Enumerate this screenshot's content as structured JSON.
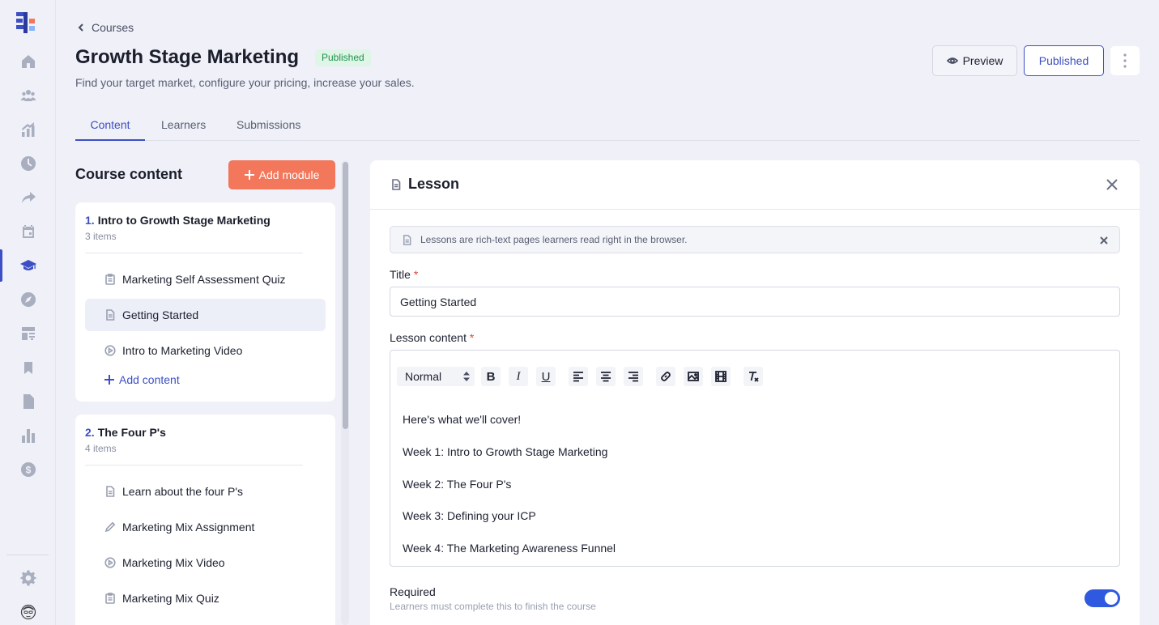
{
  "sidebar": {
    "icons": [
      "home-icon",
      "people-icon",
      "chart-up-icon",
      "clock-icon",
      "share-icon",
      "calendar-icon",
      "graduation-cap-icon",
      "compass-icon",
      "desk-icon",
      "bookmark-icon",
      "document-icon",
      "bar-chart-icon",
      "dollar-icon",
      "gear-icon",
      "avatar"
    ],
    "active": "graduation-cap-icon"
  },
  "header": {
    "back_label": "Courses",
    "title": "Growth Stage Marketing",
    "status_badge": "Published",
    "subtitle": "Find your target market, configure your pricing, increase your sales.",
    "preview_label": "Preview",
    "published_label": "Published"
  },
  "tabs": [
    {
      "label": "Content",
      "active": true
    },
    {
      "label": "Learners",
      "active": false
    },
    {
      "label": "Submissions",
      "active": false
    }
  ],
  "course_content": {
    "title": "Course content",
    "add_module_label": "Add module",
    "add_content_label": "Add content",
    "modules": [
      {
        "number": "1.",
        "title": "Intro to Growth Stage Marketing",
        "count": "3 items",
        "items": [
          {
            "label": "Marketing Self Assessment Quiz",
            "icon": "quiz-icon"
          },
          {
            "label": "Getting Started",
            "icon": "lesson-icon",
            "selected": true
          },
          {
            "label": "Intro to Marketing Video",
            "icon": "video-icon"
          }
        ]
      },
      {
        "number": "2.",
        "title": "The Four P's",
        "count": "4 items",
        "items": [
          {
            "label": "Learn about the four P's",
            "icon": "lesson-icon"
          },
          {
            "label": "Marketing Mix Assignment",
            "icon": "pencil-icon"
          },
          {
            "label": "Marketing Mix Video",
            "icon": "video-icon"
          },
          {
            "label": "Marketing Mix Quiz",
            "icon": "quiz-icon"
          }
        ]
      }
    ]
  },
  "lesson": {
    "title": "Lesson",
    "info": "Lessons are rich-text pages learners read right in the browser.",
    "title_label": "Title",
    "title_value": "Getting Started",
    "content_label": "Lesson content",
    "format_value": "Normal",
    "content_lines": [
      "Here's what we'll cover!",
      "Week 1: Intro to Growth Stage Marketing",
      "Week 2: The Four P's",
      "Week 3: Defining your ICP",
      "Week 4: The Marketing Awareness Funnel"
    ],
    "required_label": "Required",
    "required_desc": "Learners must complete this to finish the course",
    "required_on": true,
    "toolbar_bold": "B",
    "toolbar_italic": "I",
    "toolbar_underline": "U"
  },
  "colors": {
    "accent": "#3d4fc4",
    "add_module": "#f2775b",
    "badge_bg": "#dff5e6",
    "badge_text": "#219150",
    "toggle_on": "#2f5ae0"
  }
}
